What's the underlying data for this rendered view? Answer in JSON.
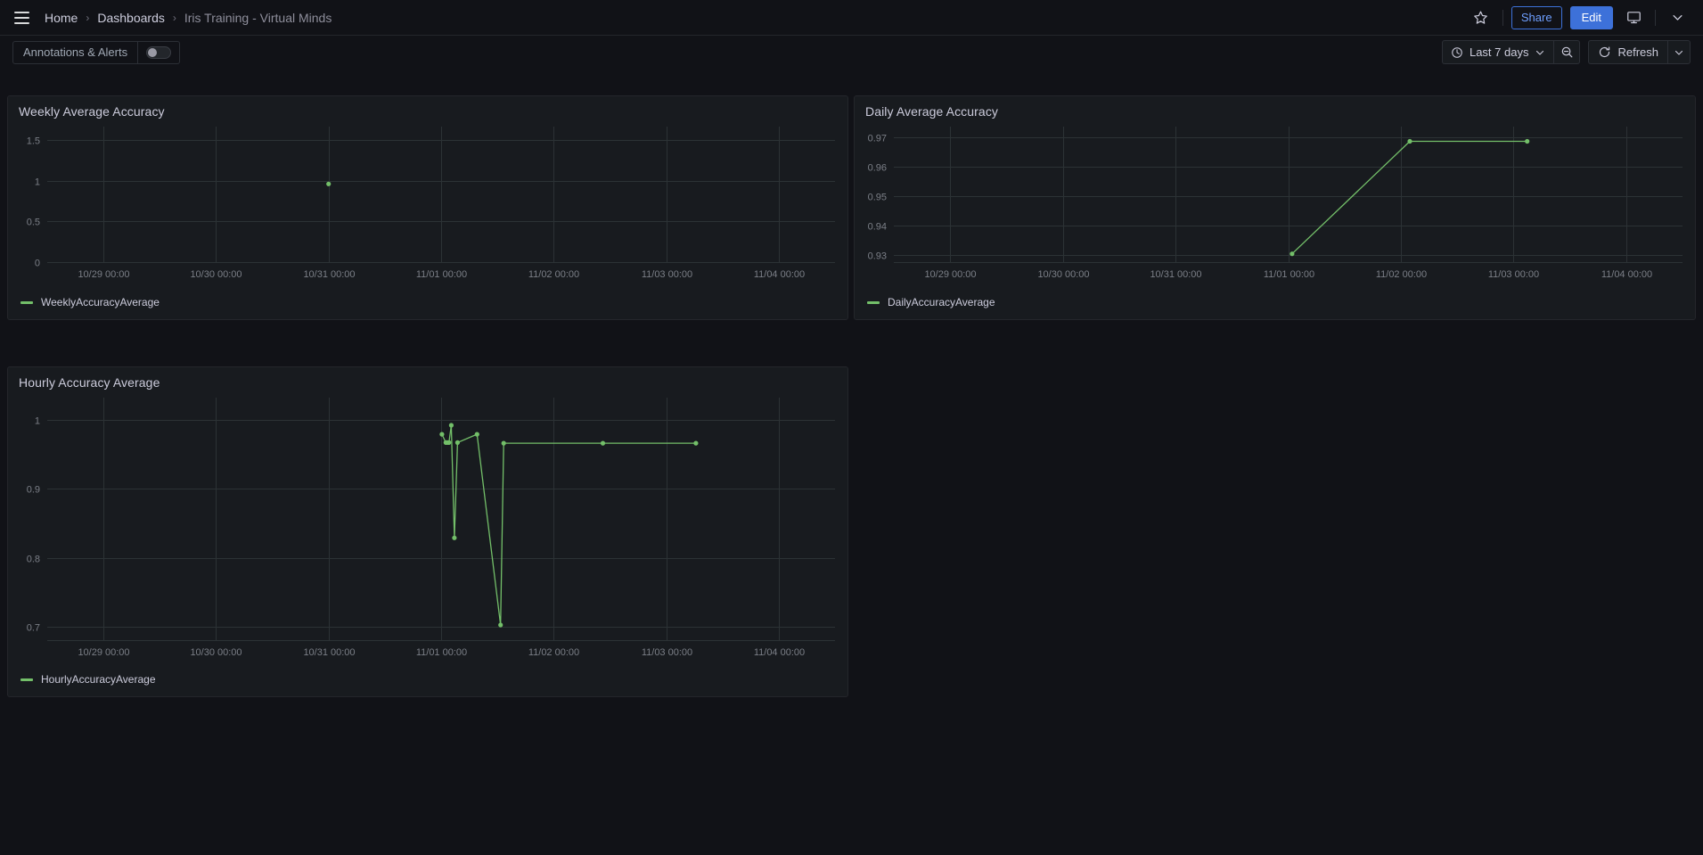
{
  "nav": {
    "menu_icon": "hamburger-icon",
    "breadcrumb": [
      {
        "label": "Home",
        "current": false
      },
      {
        "label": "Dashboards",
        "current": false
      },
      {
        "label": "Iris Training - Virtual Minds",
        "current": true
      }
    ],
    "separator": "›",
    "star_icon": "star-icon",
    "share_label": "Share",
    "edit_label": "Edit",
    "tv_icon": "tv-mode-icon",
    "more_icon": "chevron-down-icon"
  },
  "toolbar": {
    "annotations_label": "Annotations & Alerts",
    "annotations_enabled": false,
    "time_range": "Last 7 days",
    "time_icon": "clock-icon",
    "time_caret": "chevron-down-icon",
    "zoom_out_icon": "zoom-out-icon",
    "refresh_label": "Refresh",
    "refresh_icon": "refresh-icon",
    "refresh_caret": "chevron-down-icon"
  },
  "colors": {
    "series_green": "#73bf69",
    "accent_blue": "#3d71d9",
    "panel_bg": "#181b1f",
    "page_bg": "#111217"
  },
  "panels": [
    {
      "title": "Weekly Average Accuracy",
      "legend": "WeeklyAccuracyAverage"
    },
    {
      "title": "Daily Average Accuracy",
      "legend": "DailyAccuracyAverage"
    },
    {
      "title": "Hourly Accuracy Average",
      "legend": "HourlyAccuracyAverage"
    }
  ],
  "chart_data": [
    {
      "type": "line",
      "title": "Weekly Average Accuracy",
      "xlabel": "",
      "ylabel": "",
      "grid": true,
      "legend_position": "bottom-left",
      "xticks": [
        "10/29 00:00",
        "10/30 00:00",
        "10/31 00:00",
        "11/01 00:00",
        "11/02 00:00",
        "11/03 00:00",
        "11/04 00:00"
      ],
      "yticks": [
        0,
        0.5,
        1,
        1.5
      ],
      "ylim": [
        0,
        1.67
      ],
      "xlim": [
        "10/28 12:00",
        "11/04 12:00"
      ],
      "series": [
        {
          "name": "WeeklyAccuracyAverage",
          "color": "#73bf69",
          "x": [
            "10/31 00:00"
          ],
          "values": [
            0.963
          ]
        }
      ]
    },
    {
      "type": "line",
      "title": "Daily Average Accuracy",
      "xlabel": "",
      "ylabel": "",
      "grid": true,
      "legend_position": "bottom-left",
      "xticks": [
        "10/29 00:00",
        "10/30 00:00",
        "10/31 00:00",
        "11/01 00:00",
        "11/02 00:00",
        "11/03 00:00",
        "11/04 00:00"
      ],
      "yticks": [
        0.93,
        0.94,
        0.95,
        0.96,
        0.97
      ],
      "ylim": [
        0.9275,
        0.9735
      ],
      "xlim": [
        "10/28 12:00",
        "11/04 12:00"
      ],
      "series": [
        {
          "name": "DailyAccuracyAverage",
          "color": "#73bf69",
          "x": [
            "11/01 00:50",
            "11/02 01:55",
            "11/03 02:55"
          ],
          "values": [
            0.9303,
            0.9685,
            0.9685
          ]
        }
      ]
    },
    {
      "type": "line",
      "title": "Hourly Accuracy Average",
      "xlabel": "",
      "ylabel": "",
      "grid": true,
      "legend_position": "bottom-left",
      "xticks": [
        "10/29 00:00",
        "10/30 00:00",
        "10/31 00:00",
        "11/01 00:00",
        "11/02 00:00",
        "11/03 00:00",
        "11/04 00:00"
      ],
      "yticks": [
        0.7,
        0.8,
        0.9,
        1.0
      ],
      "ylim": [
        0.681,
        1.032
      ],
      "xlim": [
        "10/28 12:00",
        "11/04 12:00"
      ],
      "series": [
        {
          "name": "HourlyAccuracyAverage",
          "color": "#73bf69",
          "x": [
            "11/01 00:10",
            "11/01 01:00",
            "11/01 01:20",
            "11/01 01:40",
            "11/01 02:10",
            "11/01 02:50",
            "11/01 03:30",
            "11/01 07:40",
            "11/01 12:40",
            "11/01 13:20",
            "11/02 10:30",
            "11/03 06:20"
          ],
          "values": [
            0.979,
            0.967,
            0.967,
            0.967,
            0.992,
            0.829,
            0.967,
            0.979,
            0.703,
            0.966,
            0.966,
            0.966
          ]
        }
      ]
    }
  ]
}
